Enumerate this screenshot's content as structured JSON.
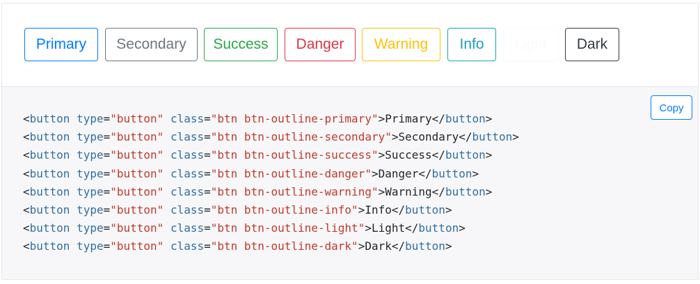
{
  "colors": {
    "primary": "#007bff",
    "secondary": "#6c757d",
    "success": "#28a745",
    "danger": "#dc3545",
    "warning": "#ffc107",
    "info": "#17a2b8",
    "light": "#f8f9fa",
    "dark": "#343a40",
    "code_tag": "#2f6f9f",
    "code_string": "#c0392b",
    "code_text": "#212529"
  },
  "buttons": [
    {
      "key": "primary",
      "label": "Primary"
    },
    {
      "key": "secondary",
      "label": "Secondary"
    },
    {
      "key": "success",
      "label": "Success"
    },
    {
      "key": "danger",
      "label": "Danger"
    },
    {
      "key": "warning",
      "label": "Warning"
    },
    {
      "key": "info",
      "label": "Info"
    },
    {
      "key": "light",
      "label": "Light"
    },
    {
      "key": "dark",
      "label": "Dark"
    }
  ],
  "copy_label": "Copy",
  "code_lines": [
    {
      "tag": "button",
      "attr_type": "type",
      "type_val": "\"button\"",
      "attr_class": "class",
      "class_val": "\"btn btn-outline-primary\"",
      "text": "Primary"
    },
    {
      "tag": "button",
      "attr_type": "type",
      "type_val": "\"button\"",
      "attr_class": "class",
      "class_val": "\"btn btn-outline-secondary\"",
      "text": "Secondary"
    },
    {
      "tag": "button",
      "attr_type": "type",
      "type_val": "\"button\"",
      "attr_class": "class",
      "class_val": "\"btn btn-outline-success\"",
      "text": "Success"
    },
    {
      "tag": "button",
      "attr_type": "type",
      "type_val": "\"button\"",
      "attr_class": "class",
      "class_val": "\"btn btn-outline-danger\"",
      "text": "Danger"
    },
    {
      "tag": "button",
      "attr_type": "type",
      "type_val": "\"button\"",
      "attr_class": "class",
      "class_val": "\"btn btn-outline-warning\"",
      "text": "Warning"
    },
    {
      "tag": "button",
      "attr_type": "type",
      "type_val": "\"button\"",
      "attr_class": "class",
      "class_val": "\"btn btn-outline-info\"",
      "text": "Info"
    },
    {
      "tag": "button",
      "attr_type": "type",
      "type_val": "\"button\"",
      "attr_class": "class",
      "class_val": "\"btn btn-outline-light\"",
      "text": "Light"
    },
    {
      "tag": "button",
      "attr_type": "type",
      "type_val": "\"button\"",
      "attr_class": "class",
      "class_val": "\"btn btn-outline-dark\"",
      "text": "Dark"
    }
  ]
}
